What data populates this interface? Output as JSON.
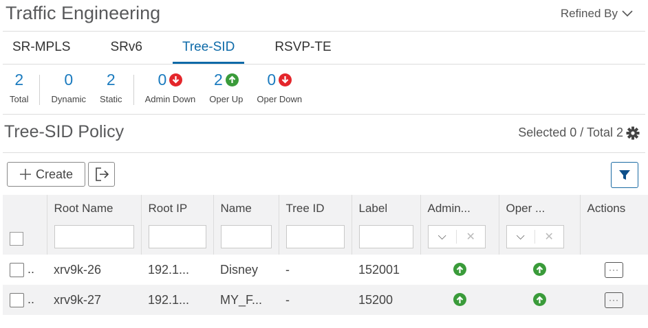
{
  "header": {
    "title": "Traffic Engineering",
    "refined_by": "Refined By"
  },
  "tabs": [
    {
      "label": "SR-MPLS",
      "active": false
    },
    {
      "label": "SRv6",
      "active": false
    },
    {
      "label": "Tree-SID",
      "active": true
    },
    {
      "label": "RSVP-TE",
      "active": false
    }
  ],
  "stats": {
    "total": {
      "value": "2",
      "label": "Total"
    },
    "dynamic": {
      "value": "0",
      "label": "Dynamic"
    },
    "static": {
      "value": "2",
      "label": "Static"
    },
    "admin_down": {
      "value": "0",
      "label": "Admin Down",
      "icon": "arrow-down-icon"
    },
    "oper_up": {
      "value": "2",
      "label": "Oper Up",
      "icon": "arrow-up-icon"
    },
    "oper_down": {
      "value": "0",
      "label": "Oper Down",
      "icon": "arrow-down-icon"
    }
  },
  "policy": {
    "title": "Tree-SID Policy",
    "selected_text": "Selected 0 / Total 2"
  },
  "toolbar": {
    "create_label": "Create"
  },
  "table": {
    "columns": [
      "Root Name",
      "Root IP",
      "Name",
      "Tree ID",
      "Label",
      "Admin...",
      "Oper ...",
      "Actions"
    ],
    "rows": [
      {
        "prefix": "..",
        "root_name": "xrv9k-26",
        "root_ip": "192.1...",
        "name": "Disney",
        "tree_id": "-",
        "label": "152001",
        "admin": "up",
        "oper": "up",
        "actions": "···"
      },
      {
        "prefix": "..",
        "root_name": "xrv9k-27",
        "root_ip": "192.1...",
        "name": "MY_F...",
        "tree_id": "-",
        "label": "15200",
        "admin": "up",
        "oper": "up",
        "actions": "···"
      }
    ]
  },
  "colors": {
    "accent": "#0d6aa8",
    "up": "#3a9b3a",
    "down": "#e4262b"
  }
}
